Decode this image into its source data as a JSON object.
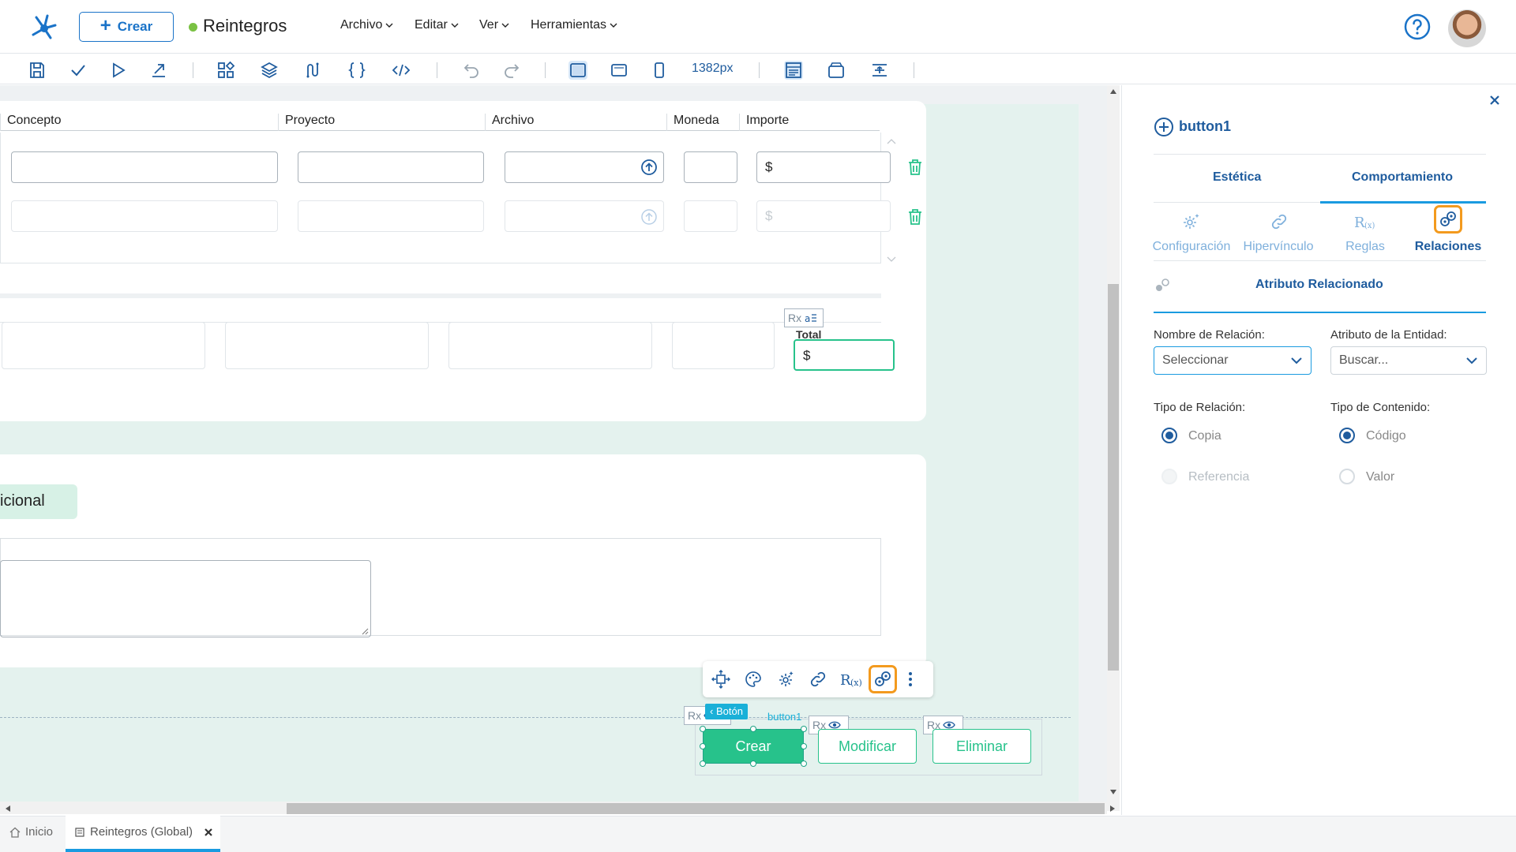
{
  "header": {
    "create_label": "Crear",
    "title": "Reintegros",
    "status_color": "#7ac143",
    "menus": [
      {
        "label": "Archivo"
      },
      {
        "label": "Editar"
      },
      {
        "label": "Ver"
      },
      {
        "label": "Herramientas"
      }
    ]
  },
  "toolbar": {
    "zoom": "1382px",
    "icons": [
      "save-icon",
      "check-icon",
      "play-icon",
      "export-icon",
      "components-icon",
      "layers-icon",
      "flow-icon",
      "braces-icon",
      "code-icon",
      "undo-icon",
      "redo-icon",
      "desktop-view-icon",
      "tablet-view-icon",
      "mobile-view-icon",
      "layout-icon",
      "window-icon",
      "align-icon"
    ]
  },
  "canvas": {
    "grid_headers": [
      "Concepto",
      "Proyecto",
      "Archivo",
      "Moneda",
      "Importe"
    ],
    "currency_symbol": "$",
    "total_label": "Total",
    "section_title_fragment": "icional",
    "rx_label": "Rx",
    "selected_component": {
      "type_label": "Botón",
      "name": "button1"
    },
    "buttons": [
      {
        "label": "Crear"
      },
      {
        "label": "Modificar"
      },
      {
        "label": "Eliminar"
      }
    ]
  },
  "panel": {
    "component_name": "button1",
    "tabs": [
      {
        "label": "Estética"
      },
      {
        "label": "Comportamiento"
      }
    ],
    "subtabs": [
      {
        "label": "Configuración",
        "icon": "gear-sparkle-icon"
      },
      {
        "label": "Hipervínculo",
        "icon": "link-icon"
      },
      {
        "label": "Reglas",
        "icon": "rules-icon"
      },
      {
        "label": "Relaciones",
        "icon": "relations-icon"
      }
    ],
    "section_title": "Atributo Relacionado",
    "relation_name_label": "Nombre de Relación:",
    "relation_name_value": "Seleccionar",
    "entity_attr_label": "Atributo de la Entidad:",
    "entity_attr_placeholder": "Buscar...",
    "relation_type_label": "Tipo de Relación:",
    "relation_type_options": [
      "Copia",
      "Referencia"
    ],
    "content_type_label": "Tipo de Contenido:",
    "content_type_options": [
      "Código",
      "Valor"
    ]
  },
  "bottom_tabs": [
    {
      "label": "Inicio"
    },
    {
      "label": "Reintegros (Global)"
    }
  ],
  "colors": {
    "brand_blue": "#1f5c9e",
    "accent_green": "#27c28b",
    "highlight_orange": "#f39a1e"
  }
}
